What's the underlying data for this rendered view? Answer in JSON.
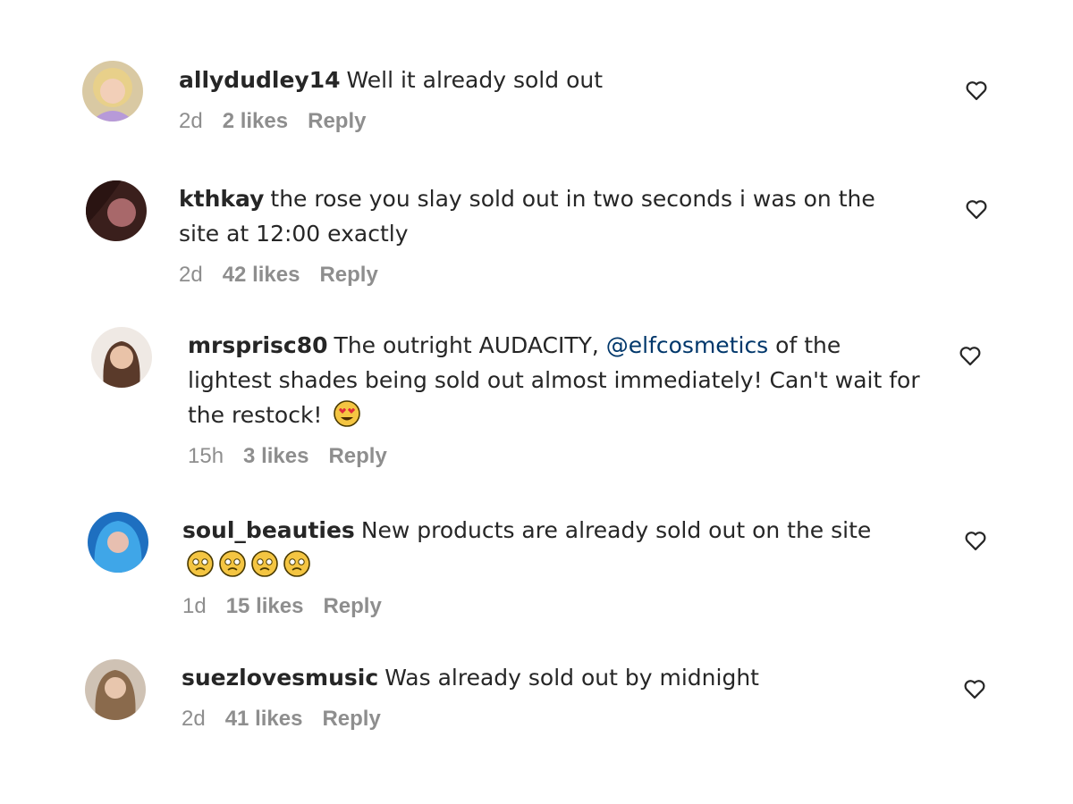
{
  "comments": [
    {
      "username": "allydudley14",
      "text": "Well it already sold out",
      "time": "2d",
      "likes": "2 likes",
      "reply": "Reply",
      "avatar": "avatar-blonde-woman"
    },
    {
      "username": "kthkay",
      "text": "the rose you slay sold out in two seconds i was on the site at 12:00 exactly",
      "time": "2d",
      "likes": "42 likes",
      "reply": "Reply",
      "avatar": "avatar-dark-hair-woman"
    },
    {
      "username": "mrsprisc80",
      "text_before": "The outright AUDACITY, ",
      "mention": "@elfcosmetics",
      "text_after": " of the lightest shades being sold out almost immediately! Can't wait for the restock! ",
      "emoji": "heart-eyes-emoji",
      "time": "15h",
      "likes": "3 likes",
      "reply": "Reply",
      "avatar": "avatar-brunette-woman"
    },
    {
      "username": "soul_beauties",
      "text": "New products are already sold out on the site",
      "emojis": [
        "pleading-face-emoji",
        "pleading-face-emoji",
        "pleading-face-emoji",
        "pleading-face-emoji"
      ],
      "time": "1d",
      "likes": "15 likes",
      "reply": "Reply",
      "avatar": "avatar-blue-hair-woman"
    },
    {
      "username": "suezlovesmusic",
      "text": "Was already sold out by midnight",
      "time": "2d",
      "likes": "41 likes",
      "reply": "Reply",
      "avatar": "avatar-long-hair-woman"
    }
  ],
  "icons": {
    "like": "heart-outline-icon"
  },
  "colors": {
    "text": "#262626",
    "meta": "#8e8e8e",
    "mention": "#00376b"
  }
}
